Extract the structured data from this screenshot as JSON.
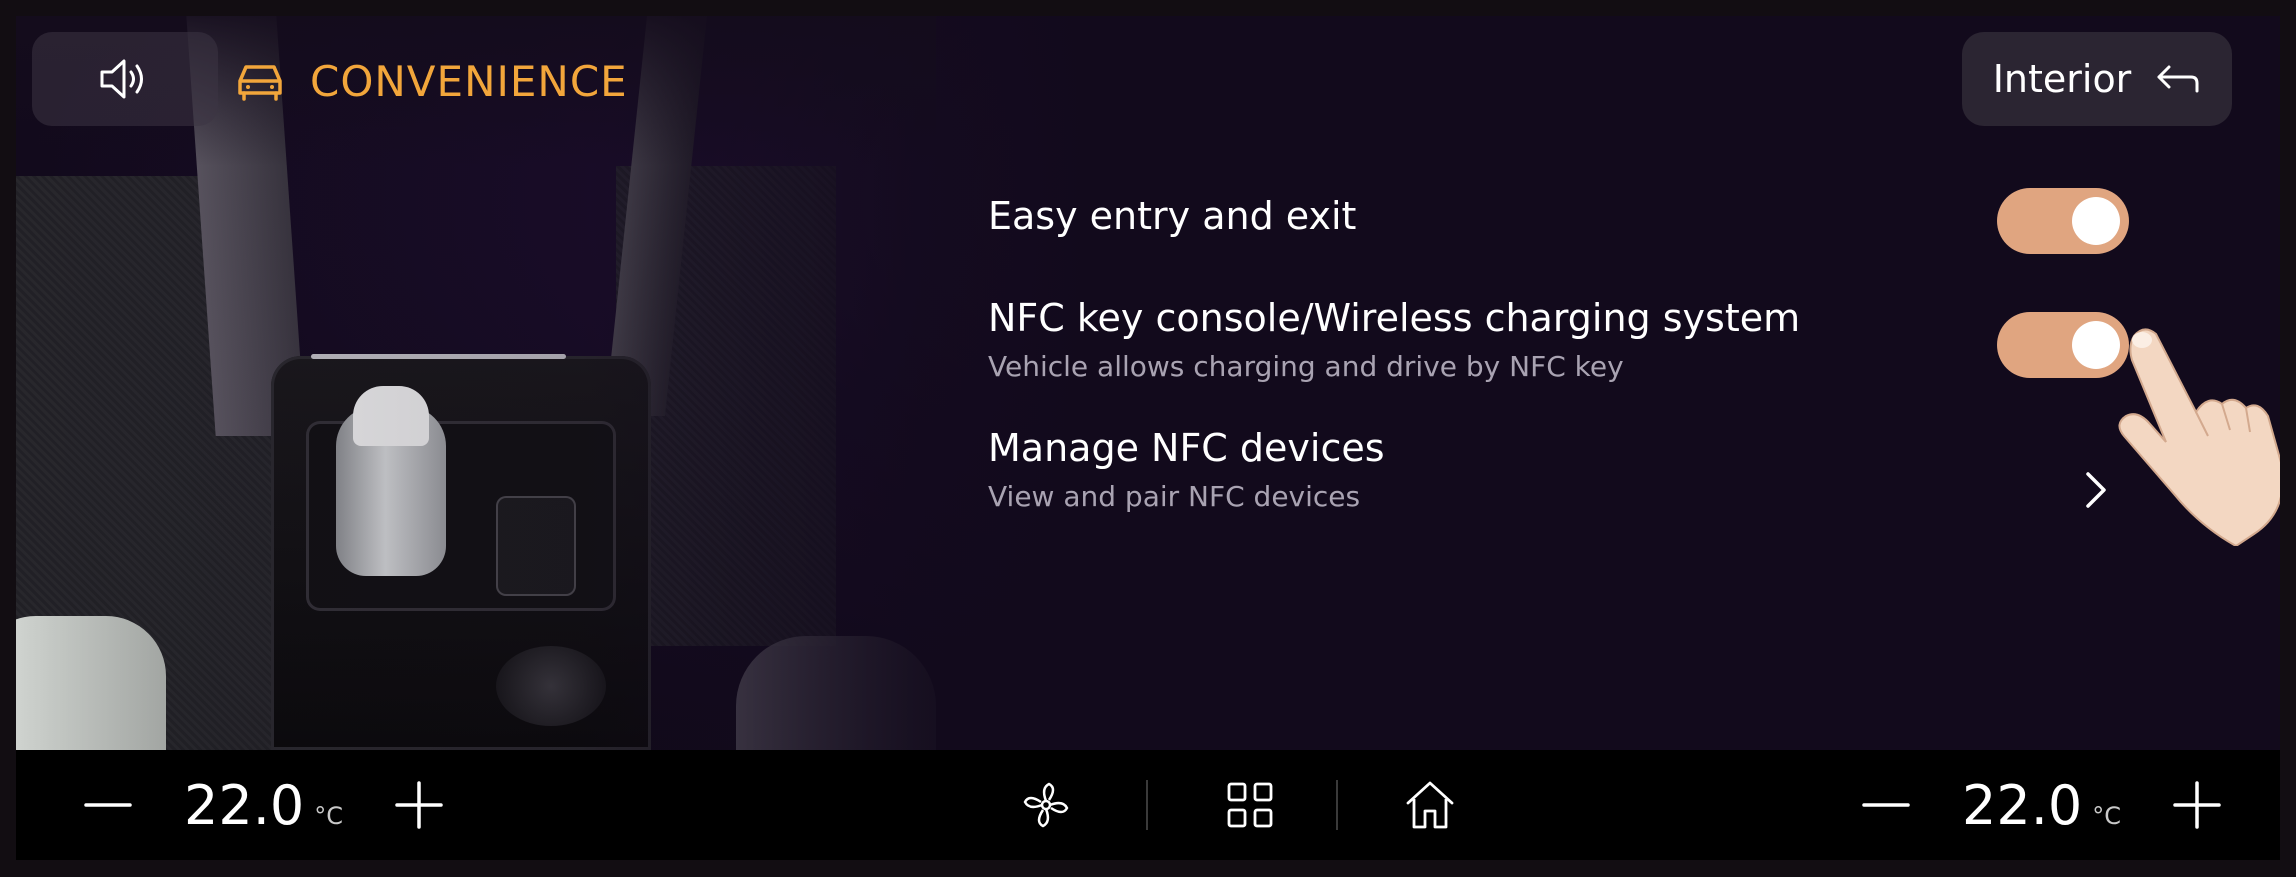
{
  "header": {
    "title": "CONVENIENCE",
    "title_icon": "car-icon",
    "speaker_icon": "speaker-icon",
    "back_label": "Interior",
    "back_icon": "back-arrow-icon",
    "accent_color": "#f2a63b"
  },
  "settings": [
    {
      "label": "Easy entry and exit",
      "description": "",
      "control": "toggle",
      "state": "on"
    },
    {
      "label": "NFC key console/Wireless charging system",
      "description": "Vehicle allows charging and drive by NFC key",
      "control": "toggle",
      "state": "on"
    },
    {
      "label": "Manage NFC devices",
      "description": "View and pair NFC devices",
      "control": "chevron",
      "state": ""
    }
  ],
  "toggle_color": "#e0a580",
  "climate": {
    "left": {
      "temp": "22.0",
      "unit": "°C"
    },
    "right": {
      "temp": "22.0",
      "unit": "°C"
    }
  },
  "bottom_nav": [
    "fan-icon",
    "apps-grid-icon",
    "home-icon"
  ]
}
